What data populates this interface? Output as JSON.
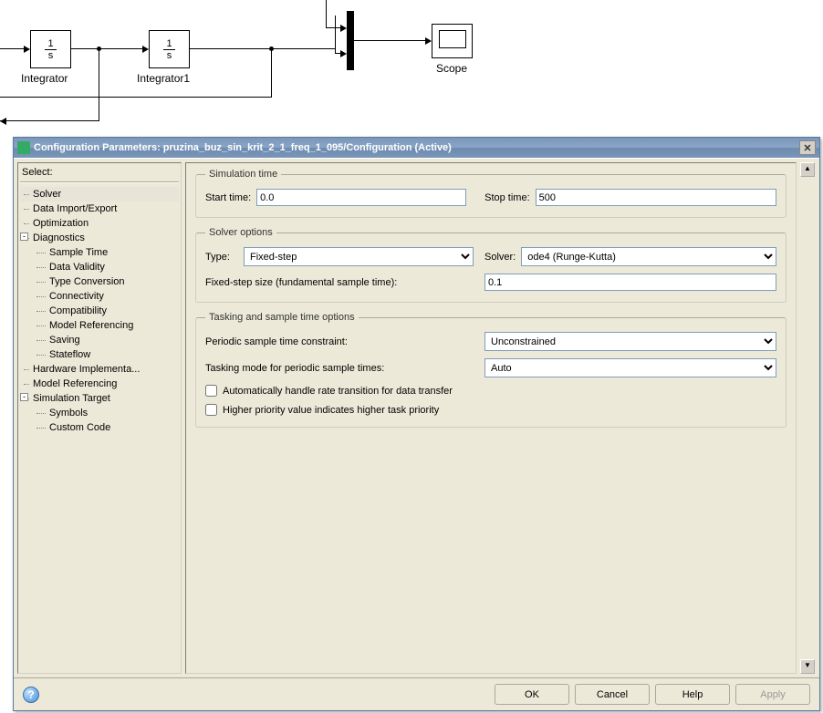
{
  "canvas": {
    "integrator1_label": "Integrator",
    "integrator2_label": "Integrator1",
    "scope_label": "Scope",
    "frac_num": "1",
    "frac_den": "s"
  },
  "dialog": {
    "title": "Configuration Parameters: pruzina_buz_sin_krit_2_1_freq_1_095/Configuration (Active)"
  },
  "tree": {
    "header": "Select:",
    "items": [
      "Solver",
      "Data Import/Export",
      "Optimization",
      "Diagnostics",
      "Sample Time",
      "Data Validity",
      "Type Conversion",
      "Connectivity",
      "Compatibility",
      "Model Referencing",
      "Saving",
      "Stateflow",
      "Hardware Implementa...",
      "Model Referencing",
      "Simulation Target",
      "Symbols",
      "Custom Code"
    ]
  },
  "sim_time": {
    "legend": "Simulation time",
    "start_label": "Start time:",
    "start_value": "0.0",
    "stop_label": "Stop time:",
    "stop_value": "500"
  },
  "solver": {
    "legend": "Solver options",
    "type_label": "Type:",
    "type_value": "Fixed-step",
    "solver_label": "Solver:",
    "solver_value": "ode4 (Runge-Kutta)",
    "step_label": "Fixed-step size (fundamental sample time):",
    "step_value": "0.1"
  },
  "tasking": {
    "legend": "Tasking and sample time options",
    "periodic_label": "Periodic sample time constraint:",
    "periodic_value": "Unconstrained",
    "mode_label": "Tasking mode for periodic sample times:",
    "mode_value": "Auto",
    "auto_handle_label": "Automatically handle rate transition for data transfer",
    "priority_label": "Higher priority value indicates higher task priority"
  },
  "footer": {
    "ok": "OK",
    "cancel": "Cancel",
    "help": "Help",
    "apply": "Apply"
  }
}
